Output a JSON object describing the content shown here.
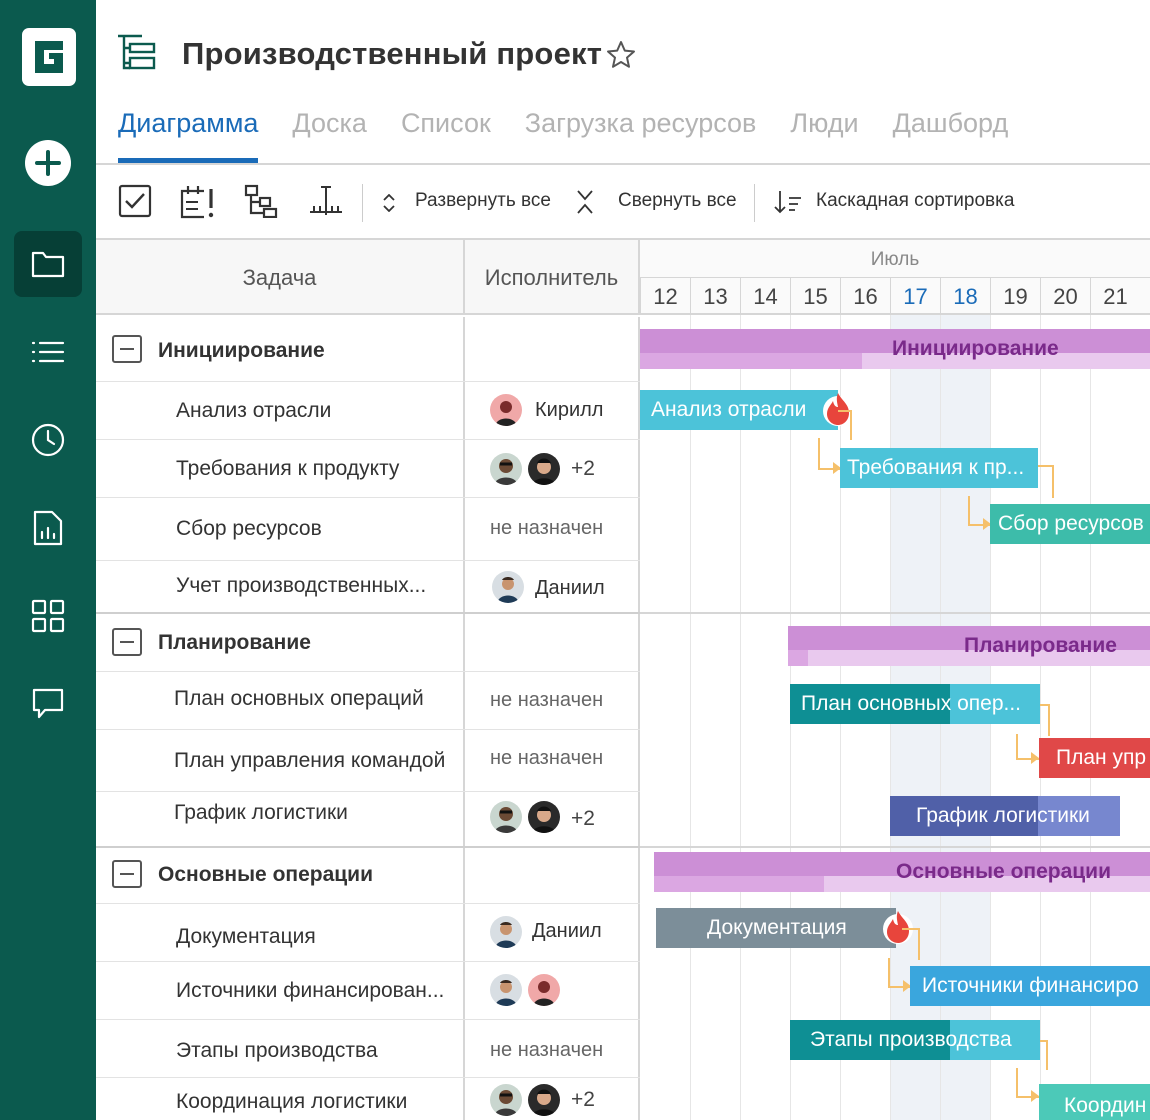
{
  "app": {
    "title": "Производственный проект"
  },
  "tabs": [
    {
      "label": "Диаграмма",
      "active": true
    },
    {
      "label": "Доска",
      "active": false
    },
    {
      "label": "Список",
      "active": false
    },
    {
      "label": "Загрузка ресурсов",
      "active": false
    },
    {
      "label": "Люди",
      "active": false
    },
    {
      "label": "Дашборд",
      "active": false
    }
  ],
  "toolbar": {
    "expand_label": "Развернуть все",
    "collapse_label": "Свернуть все",
    "sort_label": "Каскадная сортировка"
  },
  "grid": {
    "task_header": "Задача",
    "assignee_header": "Исполнитель",
    "unassigned": "не назначен"
  },
  "timeline": {
    "month": "Июль",
    "days": [
      "12",
      "13",
      "14",
      "15",
      "16",
      "17",
      "18",
      "19",
      "20",
      "21"
    ],
    "weekend_days": [
      "17",
      "18"
    ]
  },
  "groups": [
    {
      "name": "Инициирование",
      "tasks": [
        {
          "name": "Анализ отрасли",
          "assignee": "Кирилл",
          "bar_label": "Анализ отрасли"
        },
        {
          "name": "Требования к продукту",
          "assignee_more": "+2",
          "bar_label": "Требования к пр..."
        },
        {
          "name": "Сбор ресурсов",
          "assignee": "не назначен",
          "bar_label": "Сбор ресурсов"
        },
        {
          "name": "Учет производственных...",
          "assignee": "Даниил"
        }
      ]
    },
    {
      "name": "Планирование",
      "tasks": [
        {
          "name": "План основных операций",
          "assignee": "не назначен",
          "bar_label": "План основных опер..."
        },
        {
          "name": "План управления командой",
          "assignee": "не назначен",
          "bar_label": "План упр"
        },
        {
          "name": "График логистики",
          "assignee_more": "+2",
          "bar_label": "График логистики"
        }
      ]
    },
    {
      "name": "Основные операции",
      "tasks": [
        {
          "name": "Документация",
          "assignee": "Даниил",
          "bar_label": "Документация"
        },
        {
          "name": "Источники финансирован...",
          "bar_label": "Источники финансиро"
        },
        {
          "name": "Этапы производства",
          "assignee": "не назначен",
          "bar_label": "Этапы производства"
        },
        {
          "name": "Координация логистики",
          "assignee_more": "+2",
          "bar_label": "Координ"
        }
      ]
    }
  ],
  "colors": {
    "sidebar": "#0b5a4e",
    "accent": "#1a6bb8",
    "summary": "#cc8fd6",
    "task_cyan": "#4cc3d9",
    "task_teal": "#3dbcaa",
    "task_dark_teal": "#0e8f94",
    "task_red": "#e04848",
    "task_indigo": "#5060a8",
    "task_gray": "#7c8e99",
    "task_blue": "#3aa6dd",
    "connector": "#f5c06a"
  },
  "icons": [
    "logo-icon",
    "add-icon",
    "folder-icon",
    "list-icon",
    "clock-icon",
    "report-icon",
    "grid-icon",
    "chat-icon",
    "star-icon",
    "fire-icon"
  ]
}
